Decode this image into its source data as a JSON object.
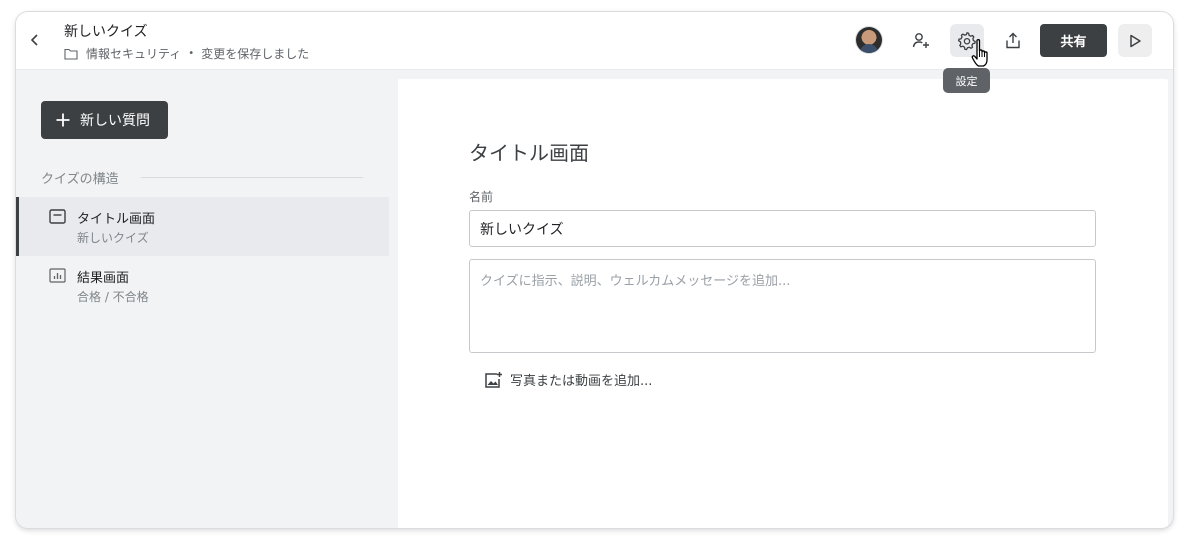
{
  "header": {
    "title": "新しいクイズ",
    "folder": "情報セキュリティ",
    "separator": "•",
    "save_status": "変更を保存しました",
    "share_label": "共有",
    "settings_tooltip": "設定"
  },
  "sidebar": {
    "new_question_label": "新しい質問",
    "section_label": "クイズの構造",
    "items": [
      {
        "title": "タイトル画面",
        "subtitle": "新しいクイズ",
        "icon": "title-screen-icon",
        "active": true
      },
      {
        "title": "結果画面",
        "subtitle": "合格 / 不合格",
        "icon": "chart-icon",
        "active": false
      }
    ]
  },
  "main": {
    "heading": "タイトル画面",
    "name_label": "名前",
    "name_value": "新しいクイズ",
    "description_placeholder": "クイズに指示、説明、ウェルカムメッセージを追加...",
    "add_media_label": "写真または動画を追加..."
  },
  "colors": {
    "accent_dark": "#3c4043",
    "sidebar_bg": "#f1f3f4",
    "active_bg": "#e8eaed",
    "tooltip_bg": "#5f6368"
  }
}
